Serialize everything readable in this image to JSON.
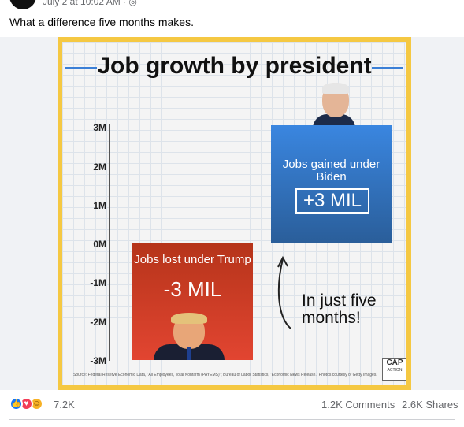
{
  "post": {
    "timestamp": "July 2 at 10:02 AM ·",
    "globe_icon": "globe-icon",
    "text": "What a difference five months makes."
  },
  "graphic": {
    "title": "Job growth by president",
    "yticks": [
      "3M",
      "2M",
      "1M",
      "0M",
      "-1M",
      "-2M",
      "-3M"
    ],
    "trump_label": "Jobs lost under Trump",
    "trump_value": "-3 MIL",
    "biden_label": "Jobs gained under Biden",
    "biden_value": "+3 MIL",
    "annotation_line1": "In just five",
    "annotation_line2": "months!",
    "source": "Source: Federal Reserve Economic Data, “All Employees, Total Nonfarm (PAYEMS)”; Bureau of Labor Statistics, “Economic News Release.” Photos courtesy of Getty Images.",
    "logo_main": "CAP",
    "logo_sub": "ACTION",
    "colors": {
      "frame": "#f5c842",
      "trump_bar": "#d23c26",
      "biden_bar": "#3a7fd4"
    }
  },
  "chart_data": {
    "type": "bar",
    "title": "Job growth by president",
    "categories": [
      "Jobs lost under Trump",
      "Jobs gained under Biden"
    ],
    "values": [
      -3000000,
      3000000
    ],
    "ylim": [
      -3000000,
      3000000
    ],
    "ytick_labels": [
      "3M",
      "2M",
      "1M",
      "0M",
      "-1M",
      "-2M",
      "-3M"
    ]
  },
  "footer": {
    "reactions_count": "7.2K",
    "comments": "1.2K Comments",
    "shares": "2.6K Shares"
  }
}
